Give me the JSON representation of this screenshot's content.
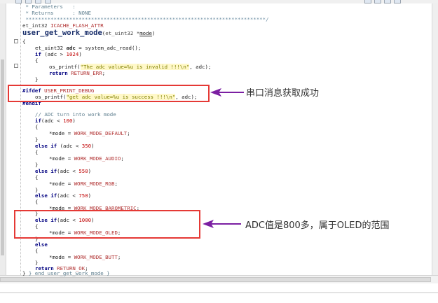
{
  "header_comment": {
    "parameters_label": " * Parameters   :",
    "returns_label": " * Returns      : NONE",
    "separator": " *****************************************************************************/"
  },
  "decl": {
    "type": "et_int32",
    "macro": "ICACHE_FLASH_ATTR",
    "func": "user_get_work_mode",
    "open_paren": "(",
    "param_type": "et_uint32 *",
    "param": "mode",
    "close_paren": ")"
  },
  "code": {
    "brace_open": "{",
    "adc_decl_type": "et_uint32 ",
    "adc_decl_var": "adc",
    "adc_decl_rest": " = system_adc_read();",
    "if1_kw": "if",
    "if1_pre": " (adc > ",
    "if1_num": "1024",
    "if1_post": ")",
    "inner_open": "{",
    "printf1_fn": "os_printf(",
    "printf1_str": "\"The adc value=%u is invalid !!!\\n\"",
    "printf1_rest": ", adc);",
    "return_err_kw": "return ",
    "return_err_val": "RETURN_ERR",
    "return_err_end": ";",
    "inner_close": "}",
    "ifdef_kw": "#ifdef ",
    "ifdef_macro": "USER_PRINT_DEBUG",
    "printf2_fn": "os_printf(",
    "printf2_str": "\"get adc value=%u is success !!!\\n\"",
    "printf2_rest": ", adc);",
    "endif_kw": "#endif",
    "comment_adc": "// ADC turn into work mode",
    "if2_kw": "if",
    "if2_pre": "(adc < ",
    "if2_num": "100",
    "if2_post": ")",
    "assign_prefix": "*mode = ",
    "mode_default": "WORK_MODE_DEFAULT",
    "elseif_kw": "else if",
    "elseif3_pre": " (adc < ",
    "num_350": "350",
    "mode_audio": "WORK_MODE_AUDIO",
    "elseif4_pre": "(adc < ",
    "num_550": "550",
    "mode_rgb": "WORK_MODE_RGB",
    "num_750": "750",
    "mode_barometric": "WORK_MODE_BAROMETRIC",
    "num_1000": "1000",
    "mode_oled": "WORK_MODE_OLED",
    "else_kw": "else",
    "mode_butt": "WORK_MODE_BUTT",
    "return_ok_kw": "return ",
    "return_ok_val": "RETURN_OK",
    "semicolon": ";",
    "close_paren": ")",
    "end_brace": "}",
    "end_comment": " } end user_get_work_mode }"
  },
  "annotations": {
    "serial_success": "串口消息获取成功",
    "adc_oled": "ADC值是800多，属于OLED的范围"
  },
  "colors": {
    "annotation_border": "#e53935",
    "arrow": "#7b1fa2"
  }
}
